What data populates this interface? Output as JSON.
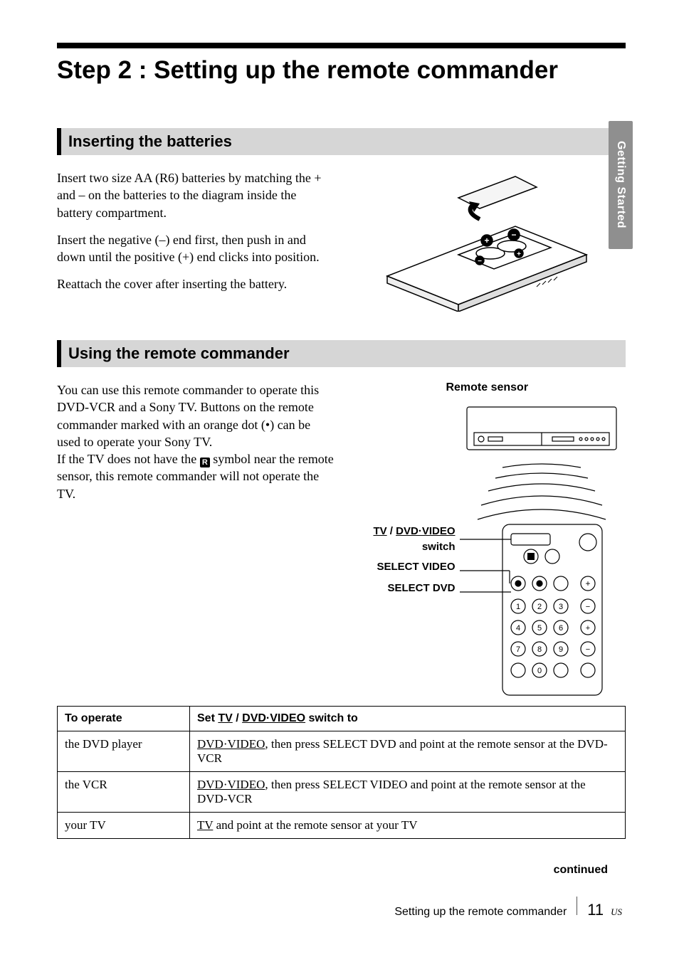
{
  "title": "Step 2 : Setting up the remote commander",
  "side_tab": "Getting Started",
  "section1": {
    "heading": "Inserting the batteries",
    "p1": "Insert two size AA (R6) batteries by matching the + and – on the batteries to the diagram inside the battery compartment.",
    "p2": "Insert the negative (–) end first, then push in and down until the positive (+) end clicks into position.",
    "p3": "Reattach the cover after inserting the battery."
  },
  "section2": {
    "heading": "Using the remote commander",
    "p1a": "You can use this remote commander to operate this DVD-VCR and a Sony TV. Buttons on the remote commander marked with an orange dot (•) can be used to operate your Sony TV.",
    "p1b_pre": "If the TV does not have the ",
    "p1b_post": " symbol near the remote sensor, this remote commander will not operate the TV.",
    "figure_labels": {
      "remote_sensor": "Remote sensor",
      "switch_label_line1": "TV",
      "switch_label_sep": " / ",
      "switch_label_line1b": "DVD·VIDEO",
      "switch_label_line2": "switch",
      "select_video": "SELECT VIDEO",
      "select_dvd": "SELECT DVD"
    }
  },
  "table": {
    "head_operate": "To operate",
    "head_switch_pre": "Set ",
    "head_switch_u1": "TV",
    "head_switch_mid": " / ",
    "head_switch_u2": "DVD·VIDEO",
    "head_switch_post": " switch to",
    "rows": [
      {
        "op": "the DVD player",
        "setting_u": "DVD·VIDEO",
        "setting_rest": ", then press SELECT DVD and point at the remote sensor at the DVD-VCR"
      },
      {
        "op": "the VCR",
        "setting_u": "DVD·VIDEO",
        "setting_rest": ", then press SELECT VIDEO and point at the remote sensor at the DVD-VCR"
      },
      {
        "op": "your TV",
        "setting_u": "TV",
        "setting_rest": " and point at the remote sensor at your TV"
      }
    ]
  },
  "continued": "continued",
  "footer": {
    "text": "Setting up the remote commander",
    "page": "11",
    "suffix": "US"
  }
}
